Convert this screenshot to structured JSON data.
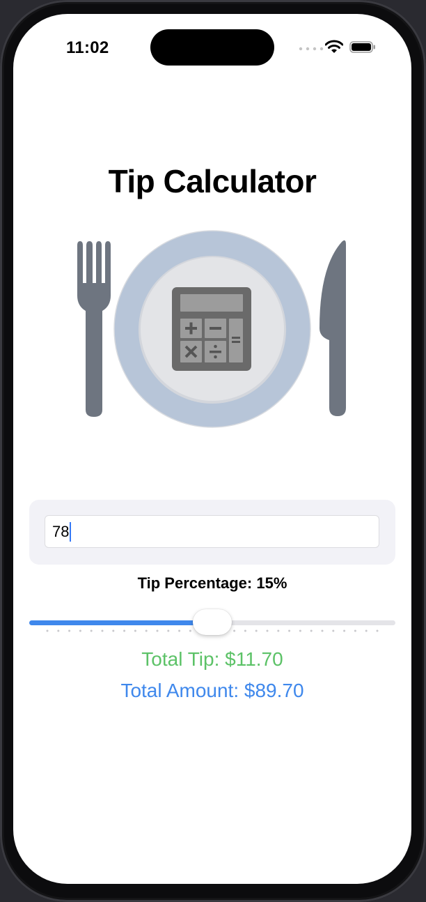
{
  "status_bar": {
    "time": "11:02"
  },
  "app": {
    "title": "Tip Calculator"
  },
  "bill": {
    "value": "78"
  },
  "tip": {
    "label": "Tip Percentage: 15%",
    "percent": 15,
    "slider_fraction": 0.5
  },
  "results": {
    "total_tip": "Total Tip: $11.70",
    "total_amount": "Total Amount: $89.70"
  },
  "icons": {
    "fork": "fork-icon",
    "plate": "plate-icon",
    "calculator": "calculator-icon",
    "knife": "knife-icon"
  },
  "colors": {
    "accent": "#3f88ec",
    "tip_green": "#5cc267",
    "plate": "#b7c5d8",
    "cutlery": "#6e7580"
  }
}
